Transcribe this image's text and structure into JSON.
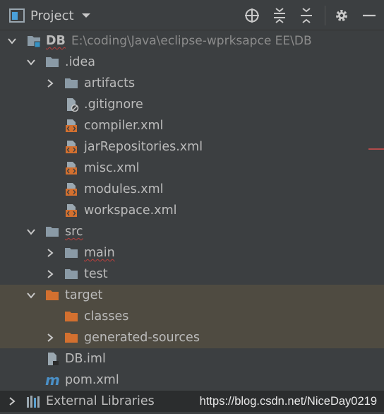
{
  "panel": {
    "title": "Project"
  },
  "tree": {
    "root": {
      "name": "DB",
      "path": "E:\\coding\\Java\\eclipse-wprksapce EE\\DB"
    },
    "idea_folder": ".idea",
    "artifacts": "artifacts",
    "gitignore": ".gitignore",
    "compiler_xml": "compiler.xml",
    "jar_repositories_xml": "jarRepositories.xml",
    "misc_xml": "misc.xml",
    "modules_xml": "modules.xml",
    "workspace_xml": "workspace.xml",
    "src": "src",
    "main": "main",
    "test": "test",
    "target": "target",
    "classes": "classes",
    "generated_sources": "generated-sources",
    "db_iml": "DB.iml",
    "pom_xml": "pom.xml",
    "external_libraries": "External Libraries"
  },
  "watermark": "https://blog.csdn.net/NiceDay0219",
  "colors": {
    "background": "#3c3f41",
    "excluded_row": "#4f4b41",
    "folder": "#8a9aa6",
    "excluded_folder": "#d3702f",
    "xml_icon": "#d3702f",
    "text": "#bbbbbb"
  },
  "icons": [
    "project-icon",
    "chevron-down-icon",
    "locate-icon",
    "expand-all-icon",
    "collapse-all-icon",
    "gear-icon",
    "minimize-icon",
    "folder-icon",
    "file-icon",
    "maven-icon",
    "library-icon"
  ]
}
